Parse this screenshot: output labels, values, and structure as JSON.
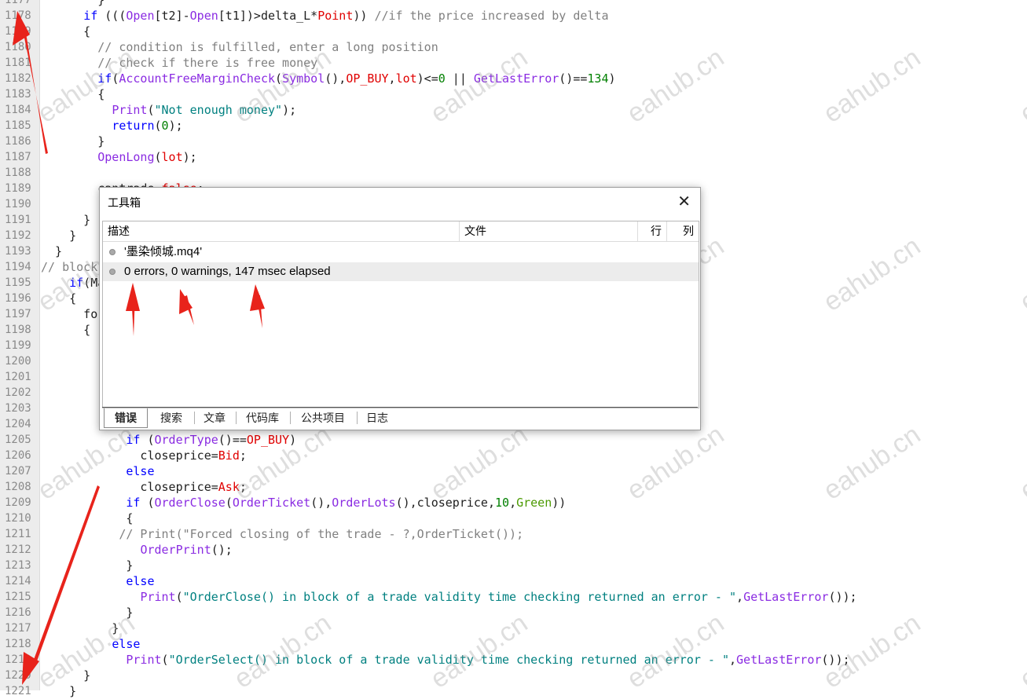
{
  "editor": {
    "lines": [
      {
        "no": "1177",
        "code": "        }"
      },
      {
        "no": "1178",
        "code": "      if (((Open[t2]-Open[t1])>delta_L*Point)) //if the price increased by delta"
      },
      {
        "no": "1179",
        "code": "      {"
      },
      {
        "no": "1180",
        "code": "        // condition is fulfilled, enter a long position"
      },
      {
        "no": "1181",
        "code": "        // check if there is free money"
      },
      {
        "no": "1182",
        "code": "        if(AccountFreeMarginCheck(Symbol(),OP_BUY,lot)<=0 || GetLastError()==134)"
      },
      {
        "no": "1183",
        "code": "        {"
      },
      {
        "no": "1184",
        "code": "          Print(\"Not enough money\");"
      },
      {
        "no": "1185",
        "code": "          return(0);"
      },
      {
        "no": "1186",
        "code": "        }"
      },
      {
        "no": "1187",
        "code": "        OpenLong(lot);"
      },
      {
        "no": "1188",
        "code": ""
      },
      {
        "no": "1189",
        "code": "        cantrade=false;"
      },
      {
        "no": "1190",
        "code": ""
      },
      {
        "no": "1191",
        "code": "      }"
      },
      {
        "no": "1192",
        "code": "    }"
      },
      {
        "no": "1193",
        "code": "  }"
      },
      {
        "no": "1194",
        "code": "// block"
      },
      {
        "no": "1195",
        "code": "    if(Ma"
      },
      {
        "no": "1196",
        "code": "    {"
      },
      {
        "no": "1197",
        "code": "      fo"
      },
      {
        "no": "1198",
        "code": "      {"
      },
      {
        "no": "1199",
        "code": ""
      },
      {
        "no": "1200",
        "code": ""
      },
      {
        "no": "1201",
        "code": ""
      },
      {
        "no": "1202",
        "code": ""
      },
      {
        "no": "1203",
        "code": ""
      },
      {
        "no": "1204",
        "code": ""
      },
      {
        "no": "1205",
        "code": "            if (OrderType()==OP_BUY)"
      },
      {
        "no": "1206",
        "code": "              closeprice=Bid;"
      },
      {
        "no": "1207",
        "code": "            else"
      },
      {
        "no": "1208",
        "code": "              closeprice=Ask;"
      },
      {
        "no": "1209",
        "code": "            if (OrderClose(OrderTicket(),OrderLots(),closeprice,10,Green))"
      },
      {
        "no": "1210",
        "code": "            {"
      },
      {
        "no": "1211",
        "code": "           // Print(\"Forced closing of the trade - ?,OrderTicket());"
      },
      {
        "no": "1212",
        "code": "              OrderPrint();"
      },
      {
        "no": "1213",
        "code": "            }"
      },
      {
        "no": "1214",
        "code": "            else"
      },
      {
        "no": "1215",
        "code": "              Print(\"OrderClose() in block of a trade validity time checking returned an error - \",GetLastError());"
      },
      {
        "no": "1216",
        "code": "            }"
      },
      {
        "no": "1217",
        "code": "          }"
      },
      {
        "no": "1218",
        "code": "          else"
      },
      {
        "no": "1219",
        "code": "            Print(\"OrderSelect() in block of a trade validity time checking returned an error - \",GetLastError());"
      },
      {
        "no": "1220",
        "code": "      }"
      },
      {
        "no": "1221",
        "code": "    }"
      }
    ]
  },
  "watermark_text": "eahub.cn",
  "toolbox": {
    "title": "工具箱",
    "close_icon": "close-icon",
    "columns": [
      "描述",
      "文件",
      "行",
      "列"
    ],
    "rows": [
      {
        "text": "'墨染倾城.mq4'",
        "icon": "info-dot-icon"
      },
      {
        "text": "0 errors, 0 warnings, 147 msec elapsed",
        "icon": "info-dot-icon"
      }
    ],
    "tabs": [
      "错误",
      "搜索",
      "文章",
      "代码库",
      "公共项目",
      "日志"
    ],
    "active_tab": "错误"
  },
  "colors": {
    "keyword": "#0000ff",
    "function": "#8a2be2",
    "number": "#008000",
    "string": "#008080",
    "comment": "#808080",
    "constant": "#e00000",
    "arrow": "#e8231b"
  }
}
